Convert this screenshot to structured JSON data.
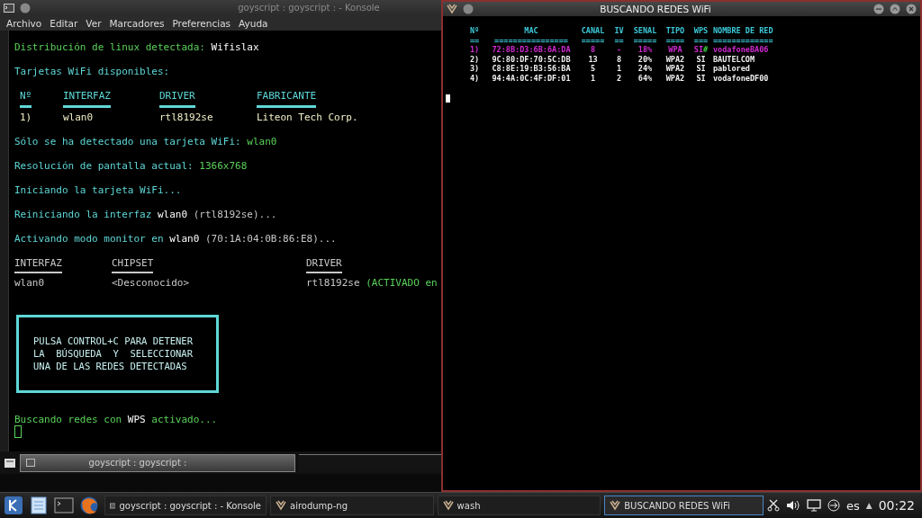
{
  "konsole": {
    "title": "goyscript : goyscript : - Konsole",
    "menu": [
      "Archivo",
      "Editar",
      "Ver",
      "Marcadores",
      "Preferencias",
      "Ayuda"
    ],
    "terminal": [
      {
        "kind": "text",
        "segments": [
          {
            "text": "Distribución de linux detectada: ",
            "color": "#5ad25a"
          },
          {
            "text": "Wifislax",
            "color": "#ffffff"
          }
        ]
      },
      {
        "kind": "text",
        "segments": [
          {
            "text": "Tarjetas WiFi disponibles:",
            "color": "#5fd7d7"
          }
        ]
      },
      {
        "kind": "cards_table",
        "columns": [
          "Nº",
          "INTERFAZ",
          "DRIVER",
          "FABRICANTE"
        ],
        "rows": [
          [
            "1)",
            "wlan0",
            "rtl8192se",
            "Liteon Tech Corp."
          ]
        ]
      },
      {
        "kind": "text",
        "segments": [
          {
            "text": "Sólo se ha detectado una tarjeta WiFi: ",
            "color": "#5fd7d7"
          },
          {
            "text": "wlan0",
            "color": "#5ad25a"
          }
        ]
      },
      {
        "kind": "text",
        "segments": [
          {
            "text": "Resolución de pantalla actual: ",
            "color": "#5fd7d7"
          },
          {
            "text": "1366x768",
            "color": "#5ad25a"
          }
        ]
      },
      {
        "kind": "text",
        "segments": [
          {
            "text": "Iniciando la tarjeta WiFi...",
            "color": "#5fd7d7"
          }
        ]
      },
      {
        "kind": "text",
        "segments": [
          {
            "text": "Reiniciando la interfaz ",
            "color": "#5fd7d7"
          },
          {
            "text": "wlan0",
            "color": "#ffffff"
          },
          {
            "text": " (rtl8192se)...",
            "color": "#c8c8c8"
          }
        ]
      },
      {
        "kind": "text",
        "segments": [
          {
            "text": "Activando modo monitor en ",
            "color": "#5fd7d7"
          },
          {
            "text": "wlan0",
            "color": "#ffffff"
          },
          {
            "text": " (70:1A:04:0B:86:E8)...",
            "color": "#c8c8c8"
          }
        ]
      },
      {
        "kind": "monitor_table",
        "columns": [
          "INTERFAZ",
          "CHIPSET",
          "DRIVER"
        ],
        "rows": [
          [
            [
              {
                "text": "wlan0",
                "color": "#c8c8c8"
              }
            ],
            [
              {
                "text": "<Desconocido>",
                "color": "#c8c8c8"
              }
            ],
            [
              {
                "text": "rtl8192se ",
                "color": "#c8c8c8"
              },
              {
                "text": "(ACTIVADO en",
                "color": "#5ad25a"
              }
            ]
          ]
        ]
      },
      {
        "kind": "box",
        "lines": [
          "PULSA CONTROL+C PARA DETENER",
          "LA  BÚSQUEDA  Y  SELECCIONAR",
          "UNA DE LAS REDES DETECTADAS"
        ]
      },
      {
        "kind": "text",
        "segments": [
          {
            "text": "Buscando redes con ",
            "color": "#5ad25a"
          },
          {
            "text": "WPS",
            "color": "#ffffff"
          },
          {
            "text": " activado...",
            "color": "#5ad25a"
          }
        ]
      }
    ],
    "tab": "goyscript : goyscript :"
  },
  "scan_window": {
    "title": "BUSCANDO REDES WiFi",
    "columns": [
      "Nº",
      "MAC",
      "CANAL",
      "IV",
      "SENAL",
      "TIPO",
      "WPS",
      "NOMBRE DE RED"
    ],
    "rules": [
      "==",
      "================",
      "=====",
      "==",
      "=====",
      "====",
      "===",
      "============="
    ],
    "rows": [
      {
        "highlighted": true,
        "cells": [
          "1)",
          "72:8B:D3:6B:6A:DA",
          "8",
          "-",
          "18%",
          "WPA",
          "SI",
          "vodafoneBA06"
        ],
        "flag": "#"
      },
      {
        "highlighted": false,
        "cells": [
          "2)",
          "9C:80:DF:70:5C:DB",
          "13",
          "8",
          "20%",
          "WPA2",
          "SI",
          "BAUTELCOM"
        ]
      },
      {
        "highlighted": false,
        "cells": [
          "3)",
          "C8:8E:19:B3:56:BA",
          "5",
          "1",
          "24%",
          "WPA2",
          "SI",
          "pablored"
        ]
      },
      {
        "highlighted": false,
        "cells": [
          "4)",
          "94:4A:0C:4F:DF:01",
          "1",
          "2",
          "64%",
          "WPA2",
          "SI",
          "vodafoneDF00"
        ]
      }
    ]
  },
  "taskbar": {
    "tasks": [
      {
        "label": "goyscript : goyscript :  - Konsole",
        "selected": false
      },
      {
        "label": "airodump-ng",
        "selected": false
      },
      {
        "label": "wash",
        "selected": false
      },
      {
        "label": "BUSCANDO REDES WiFi",
        "selected": true
      }
    ],
    "language": "es",
    "tray_arrow": "▲",
    "clock": "00:22"
  }
}
